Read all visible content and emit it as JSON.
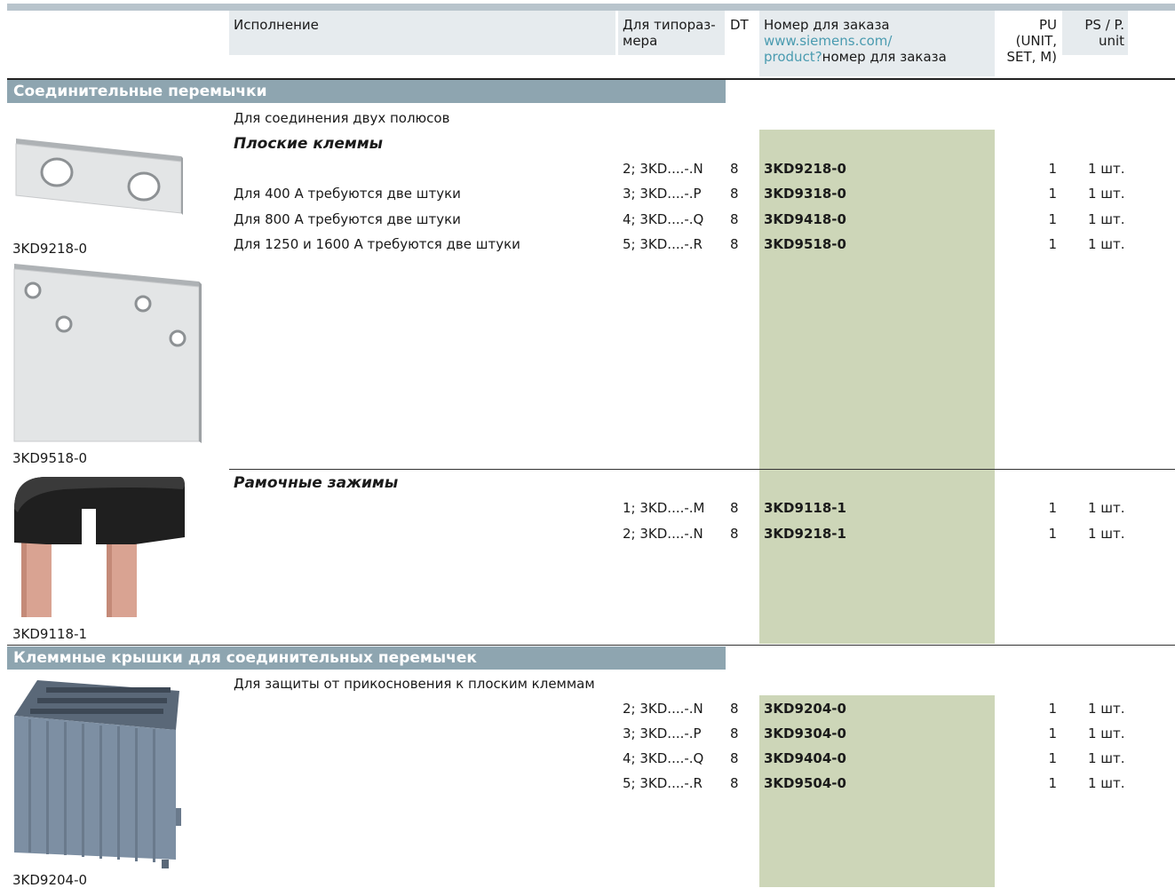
{
  "header": {
    "col_design": "Исполнение",
    "col_size": "Для типораз-\nмера",
    "col_dt": "DT",
    "col_order_title": "Номер для заказа",
    "col_order_link1": "www.siemens.com/",
    "col_order_link2": "product?",
    "col_order_suffix": "номер для заказа",
    "col_pu": "PU\n(UNIT,\nSET, M)",
    "col_ps": "PS / P.\nunit"
  },
  "sections": [
    {
      "title": "Соединительные перемычки",
      "intro": "Для соединения двух полюсов",
      "groups": [
        {
          "subtitle": "Плоские клеммы",
          "rows": [
            {
              "desc": "",
              "size": "2; 3KD....-.N",
              "dt": "8",
              "order": "3KD9218-0",
              "pu": "1",
              "ps": "1 шт."
            },
            {
              "desc": "Для 400 А требуются две штуки",
              "size": "3; 3KD....-.P",
              "dt": "8",
              "order": "3KD9318-0",
              "pu": "1",
              "ps": "1 шт."
            },
            {
              "desc": "Для 800 А требуются две штуки",
              "size": "4; 3KD....-.Q",
              "dt": "8",
              "order": "3KD9418-0",
              "pu": "1",
              "ps": "1 шт."
            },
            {
              "desc": "Для 1250 и 1600 А требуются две штуки",
              "size": "5; 3KD....-.R",
              "dt": "8",
              "order": "3KD9518-0",
              "pu": "1",
              "ps": "1 шт."
            }
          ],
          "images": [
            "3KD9218-0",
            "3KD9518-0"
          ]
        },
        {
          "subtitle": "Рамочные зажимы",
          "rows": [
            {
              "size": "1; 3KD....-.M",
              "dt": "8",
              "order": "3KD9118-1",
              "pu": "1",
              "ps": "1 шт."
            },
            {
              "size": "2; 3KD....-.N",
              "dt": "8",
              "order": "3KD9218-1",
              "pu": "1",
              "ps": "1 шт."
            }
          ],
          "images": [
            "3KD9118-1"
          ]
        }
      ]
    },
    {
      "title": "Клеммные крышки для соединительных перемычек",
      "intro": "Для защиты от прикосновения к плоским клеммам",
      "rows": [
        {
          "size": "2; 3KD....-.N",
          "dt": "8",
          "order": "3KD9204-0",
          "pu": "1",
          "ps": "1 шт."
        },
        {
          "size": "3; 3KD....-.P",
          "dt": "8",
          "order": "3KD9304-0",
          "pu": "1",
          "ps": "1 шт."
        },
        {
          "size": "4; 3KD....-.Q",
          "dt": "8",
          "order": "3KD9404-0",
          "pu": "1",
          "ps": "1 шт."
        },
        {
          "size": "5; 3KD....-.R",
          "dt": "8",
          "order": "3KD9504-0",
          "pu": "1",
          "ps": "1 шт."
        }
      ],
      "images": [
        "3KD9204-0"
      ]
    }
  ]
}
